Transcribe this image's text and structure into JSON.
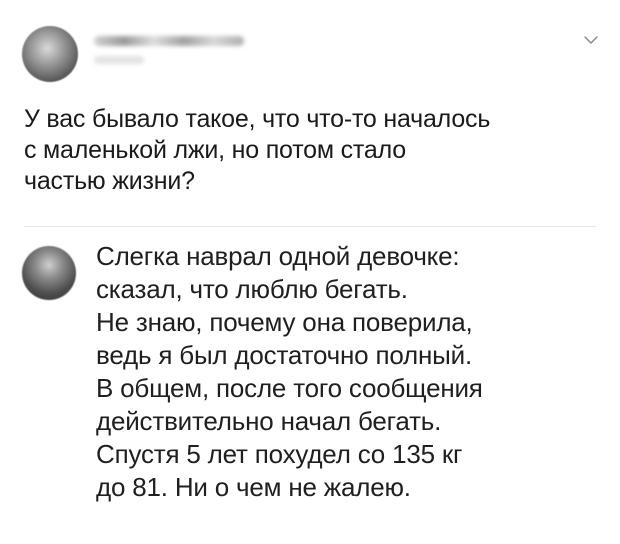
{
  "tweet": {
    "text": "У вас бывало такое, что что-то началось\nс маленькой лжи, но потом стало\nчастью жизни?"
  },
  "reply": {
    "text": "Слегка наврал одной девочке:\nсказал, что люблю бегать.\nНе знаю, почему она поверила,\nведь я был достаточно полный.\nВ общем, после того сообщения\nдействительно начал бегать.\nСпустя 5 лет похудел со 135 кг\nдо 81. Ни о чем не жалею."
  },
  "icons": {
    "menu": "chevron-down-icon"
  },
  "colors": {
    "text": "#1f1f1f",
    "divider": "#e6e6e6",
    "chevron": "#8a8a8a"
  }
}
